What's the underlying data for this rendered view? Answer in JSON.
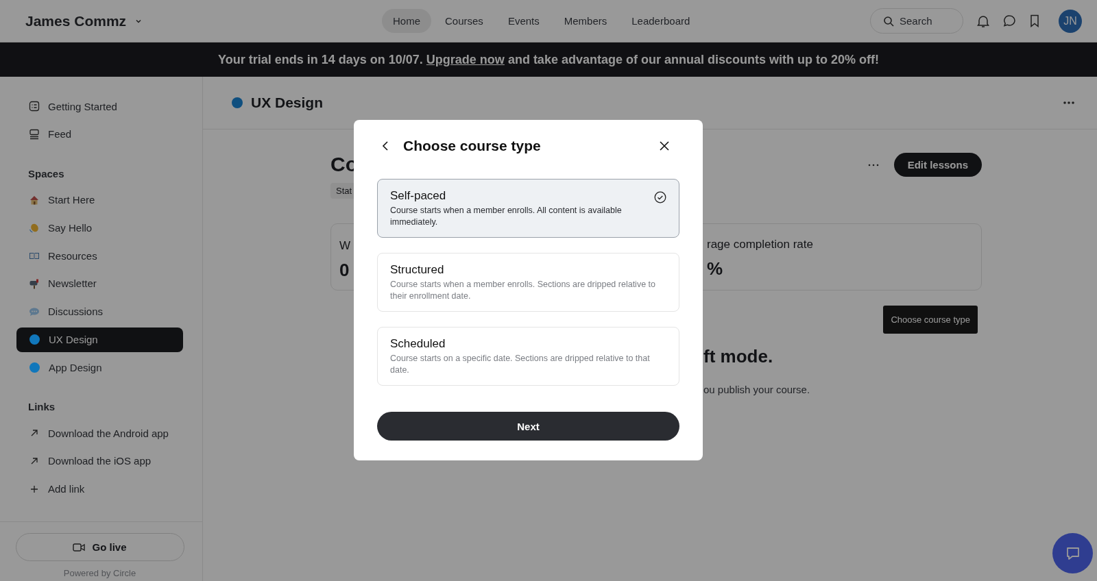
{
  "header": {
    "community": "James Commz",
    "nav": [
      {
        "label": "Home",
        "selected": true
      },
      {
        "label": "Courses",
        "selected": false
      },
      {
        "label": "Events",
        "selected": false
      },
      {
        "label": "Members",
        "selected": false
      },
      {
        "label": "Leaderboard",
        "selected": false
      }
    ],
    "search": {
      "placeholder": "Search"
    },
    "avatar": "JN"
  },
  "banner": {
    "text_before": "Your trial ends in 14 days on 10/07.",
    "link": "Upgrade now",
    "text_after": "and take advantage of our annual discounts with up to 20% off!"
  },
  "sidebar": {
    "top_items": [
      {
        "label": "Getting Started",
        "selected": false
      },
      {
        "label": "Feed",
        "selected": false
      }
    ],
    "sections": [
      {
        "title": "Spaces",
        "items": [
          {
            "kind": "emoji",
            "label": "Start Here",
            "selected": false
          },
          {
            "kind": "emoji",
            "label": "Say Hello",
            "selected": false
          },
          {
            "kind": "emoji",
            "label": "Resources",
            "selected": false
          },
          {
            "kind": "emoji",
            "label": "Newsletter",
            "selected": false
          },
          {
            "kind": "emoji",
            "label": "Discussions",
            "selected": false
          },
          {
            "kind": "dot",
            "label": "UX Design",
            "selected": true,
            "color": "#1177bb"
          },
          {
            "kind": "dot",
            "label": "App Design",
            "selected": false,
            "color": "#1177bb"
          }
        ]
      },
      {
        "title": "Links",
        "items": [
          {
            "kind": "link",
            "label": "Download the Android app",
            "selected": false
          },
          {
            "kind": "link",
            "label": "Download the iOS app",
            "selected": false
          },
          {
            "kind": "add",
            "label": "Add link",
            "selected": false
          }
        ]
      }
    ],
    "go_live": "Go live",
    "powered_by": "Powered by Circle"
  },
  "page": {
    "space_title": "UX Design",
    "title_fragment": "Co",
    "status_fragment": "Stat",
    "stat_label_fragment": "W",
    "stat_value_fragment": "0",
    "completion_label_fragment": "rage completion rate",
    "completion_value_fragment": "%",
    "edit_button": "Edit lessons",
    "tooltip": "Choose course type",
    "notice_fragment": "ft mode.",
    "notice_text_fragment": "ou publish your course."
  },
  "modal": {
    "title": "Choose course type",
    "options": [
      {
        "title": "Self-paced",
        "description": "Course starts when a member enrolls. All content is available immediately.",
        "selected": true
      },
      {
        "title": "Structured",
        "description": "Course starts when a member enrolls. Sections are dripped relative to their enrollment date.",
        "selected": false
      },
      {
        "title": "Scheduled",
        "description": "Course starts on a specific date. Sections are dripped relative to that date.",
        "selected": false
      }
    ],
    "next_button": "Next"
  }
}
